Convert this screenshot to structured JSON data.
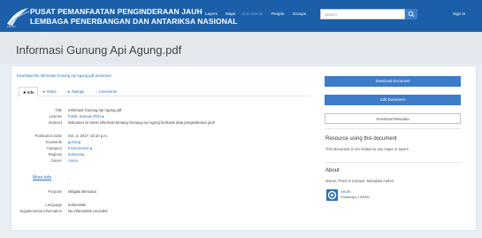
{
  "header": {
    "brand_line1": "PUSAT PEMANFAATAN PENGINDERAAN JAUH",
    "brand_line2": "LEMBAGA PENERBANGAN DAN ANTARIKSA NASIONAL",
    "brand_sub": "LAPAN",
    "nav": [
      {
        "label": "Layers",
        "active": false
      },
      {
        "label": "Maps",
        "active": false
      },
      {
        "label": "Documents",
        "active": true
      },
      {
        "label": "People",
        "active": false
      },
      {
        "label": "Groups",
        "active": false
      }
    ],
    "search_placeholder": "Search",
    "signin": "Sign in"
  },
  "page": {
    "title": "Informasi Gunung Api Agung.pdf",
    "download_link": "Download the Informasi Gunung Api Agung.pdf document"
  },
  "tabs": [
    {
      "label": "Info",
      "icon": "info-icon"
    },
    {
      "label": "Share",
      "icon": "share-icon"
    },
    {
      "label": "Ratings",
      "icon": "star-icon"
    },
    {
      "label": "Comments",
      "icon": "comment-icon"
    }
  ],
  "info": {
    "fields1": [
      {
        "label": "Title",
        "value": "Informasi Gunung Api Agung.pdf",
        "link": false
      },
      {
        "label": "License",
        "value": "Public Domain (PD)",
        "link": true
      },
      {
        "label": "Abstract",
        "value": "Dokumen ini berisi informasi tentang Gunung Api Agung berbasis data penginderaan jauh",
        "link": false
      }
    ],
    "fields2": [
      {
        "label": "Publication Date",
        "value": "Oct. 2, 2017, 10:10 p.m.",
        "link": false
      },
      {
        "label": "Keywords",
        "value": "gunung",
        "link": true
      },
      {
        "label": "Category",
        "value": "Environment",
        "link": true
      },
      {
        "label": "Regions",
        "value": "Indonesia",
        "link": true
      },
      {
        "label": "Owner",
        "value": "Anum",
        "link": true
      }
    ],
    "more_info": "More Info",
    "dash": "-",
    "fields3": [
      {
        "label": "Purpose",
        "value": "Mitigasi Bencana",
        "link": false
      },
      {
        "label": "Language",
        "value": "Indonesian",
        "link": false
      },
      {
        "label": "Supplemental Information",
        "value": "No information provided",
        "link": false
      }
    ]
  },
  "sidebar": {
    "download_btn": "Download Document",
    "edit_btn": "Edit Document",
    "metadata_btn": "Download Metadata",
    "using_title": "Resource using this document",
    "using_text": "This document is not related to any maps or layers",
    "about_title": "About",
    "about_text": "Owner, Point of Contact, Metadata Author",
    "user_name": "Anum",
    "user_org": "Pustekdja_LAPAN"
  },
  "colors": {
    "header_bg": "#1b5fa8",
    "primary": "#3d7cc9",
    "link": "#2c6fbf"
  }
}
